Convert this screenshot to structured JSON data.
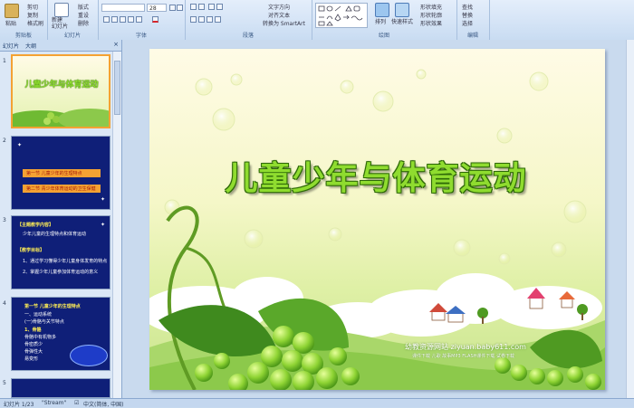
{
  "ribbon": {
    "clipboard": {
      "label": "剪贴板",
      "paste": "粘贴",
      "cut": "剪切",
      "copy": "复制",
      "format_painter": "格式刷"
    },
    "slides": {
      "label": "幻灯片",
      "new_slide": "新建\n幻灯片",
      "layout": "版式",
      "reset": "重设",
      "delete": "删除"
    },
    "font": {
      "label": "字体",
      "font_size": "28"
    },
    "paragraph": {
      "label": "段落",
      "text_direction": "文字方向",
      "align_text": "对齐文本",
      "smartart": "转换为 SmartArt"
    },
    "drawing": {
      "label": "绘图",
      "arrange": "排列",
      "quick_styles": "快速样式",
      "shape_fill": "形状填充",
      "shape_outline": "形状轮廓",
      "shape_effects": "形状效果"
    },
    "editing": {
      "label": "编辑",
      "find": "查找",
      "replace": "替换",
      "select": "选择"
    }
  },
  "panel": {
    "tab_slides": "幻灯片",
    "tab_outline": "大纲",
    "thumbs": [
      {
        "no": "1",
        "title": "儿童少年与体育运动"
      },
      {
        "no": "2",
        "lines": [
          "第一节  儿童少年的生理特点",
          "第二节  青少年体育运动的卫生保健"
        ]
      },
      {
        "no": "3",
        "lines": [
          "【主题教学内容】",
          "少年儿童的生理特点和体育运动",
          "【教学目标】",
          "1、通过学习懂得少年儿童身体发育的特点",
          "2、掌握少年儿童参加体育运动的意义"
        ]
      },
      {
        "no": "4",
        "lines": [
          "第一节  儿童少年的生理特点",
          "一、运动系统",
          "(一)骨骼与关节特点",
          "1、骨骼",
          "骨骼中有机物多",
          "骨密质少",
          "骨弹性大",
          "易变形"
        ]
      },
      {
        "no": "5"
      }
    ]
  },
  "slide": {
    "title": "儿童少年与体育运动",
    "watermark_main": "幼教资源网站  ziyuan.baby611.com",
    "watermark_sub": "课件下载    儿歌    故事MP3    FLASH课件下载    试卷下载"
  },
  "status": {
    "slide_info": "幻灯片 1/23",
    "theme": "\"Stream\"",
    "language": "中文(简体, 中国)"
  }
}
